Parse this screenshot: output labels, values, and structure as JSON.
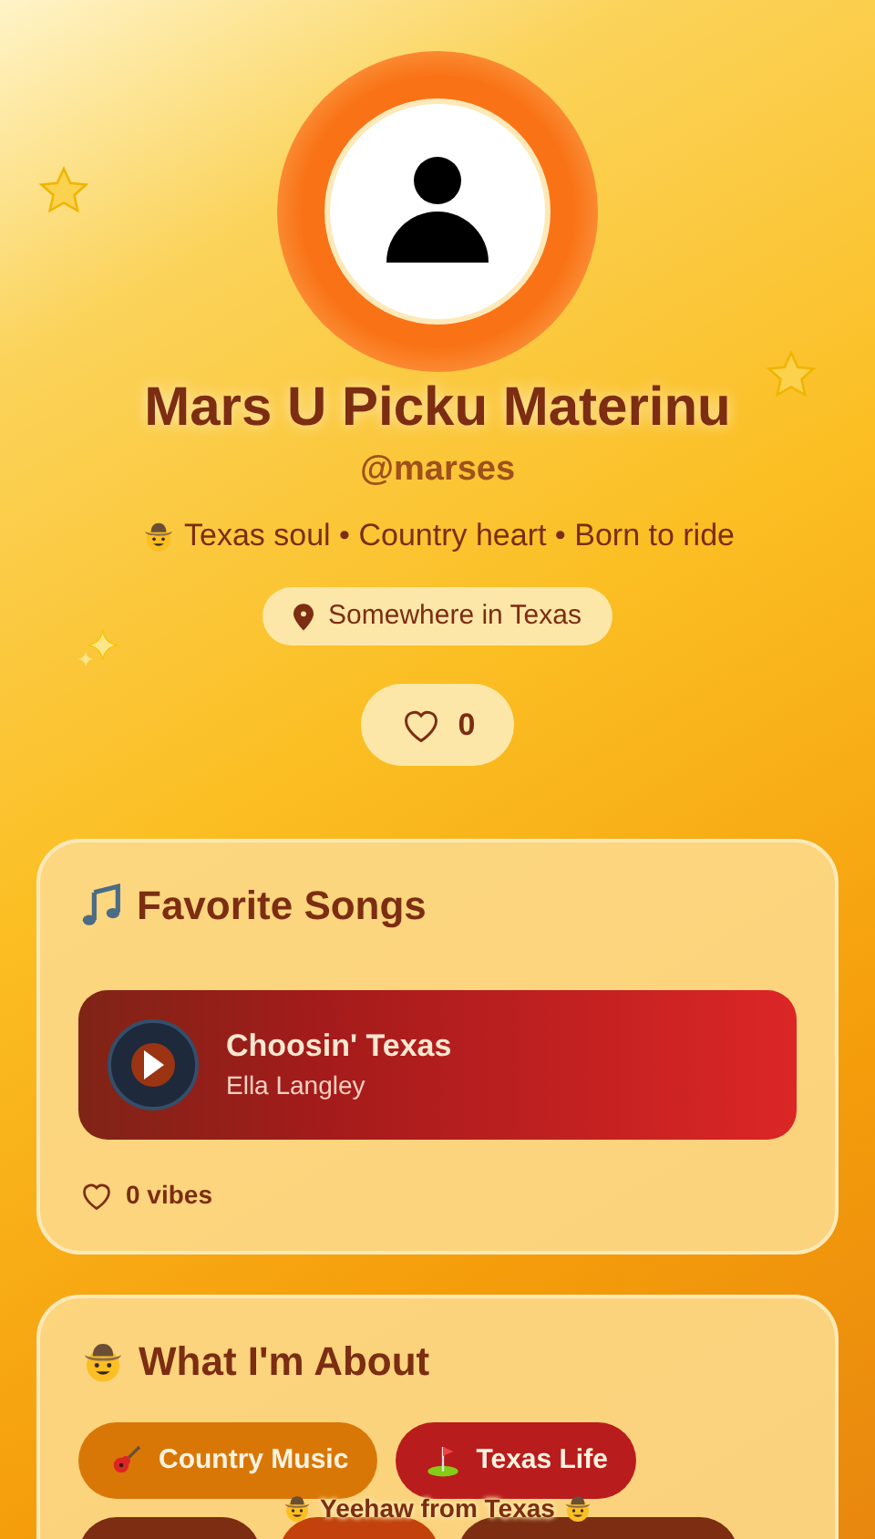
{
  "profile": {
    "name": "Mars U Picku Materinu",
    "handle": "@marses",
    "bio": "Texas soul • Country heart • Born to ride",
    "location": "Somewhere in Texas",
    "likes": "0"
  },
  "favorite_songs": {
    "title": "Favorite Songs",
    "songs": [
      {
        "title": "Choosin' Texas",
        "artist": "Ella Langley"
      }
    ],
    "vibes": "0 vibes"
  },
  "about": {
    "title": "What I'm About",
    "tags": [
      {
        "label": "Country Music",
        "color": "#d97706"
      },
      {
        "label": "Texas Life",
        "color": "#b91c1c"
      },
      {
        "color": "#7c2d12"
      },
      {
        "color": "#c2410c"
      },
      {
        "color": "#7c2d12"
      }
    ]
  },
  "footer": {
    "text": "Yeehaw from Texas"
  }
}
